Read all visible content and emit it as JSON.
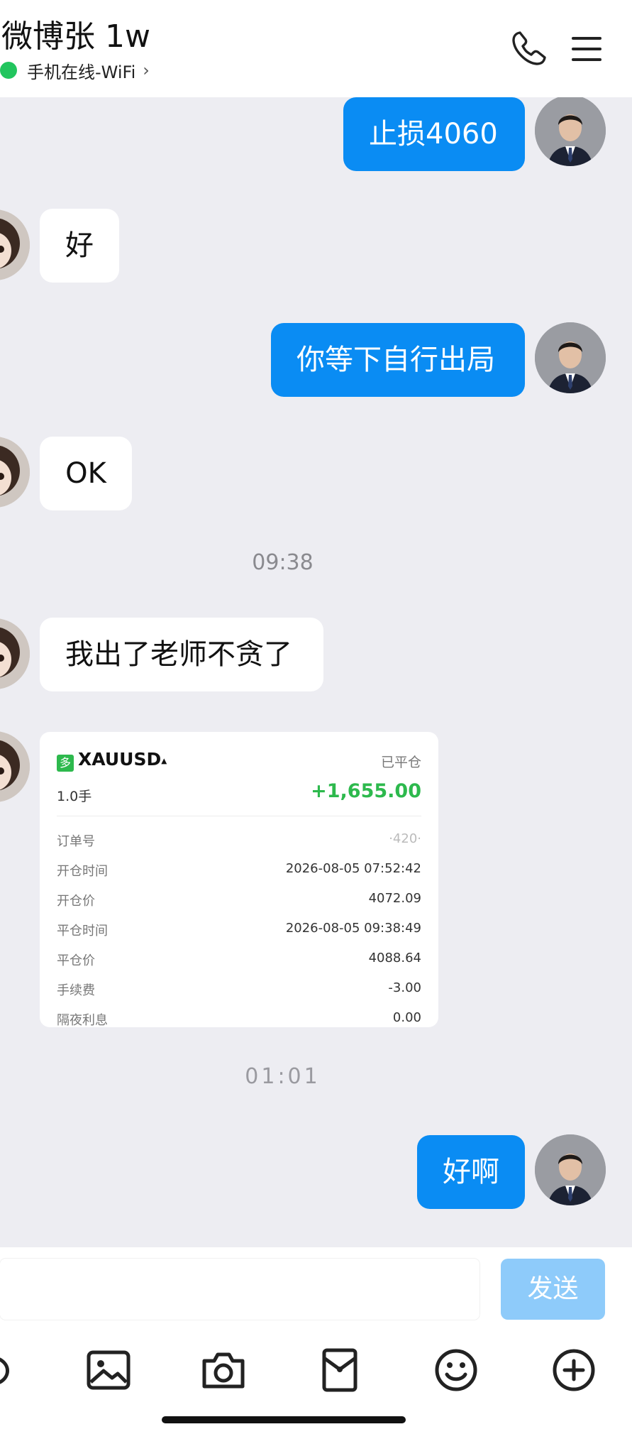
{
  "header": {
    "title": "微博张 1w",
    "status": "手机在线-WiFi",
    "status_chevron": "›",
    "icons": [
      "phone-icon",
      "menu-icon"
    ]
  },
  "messages": {
    "m1": "止损4060",
    "m2": "好",
    "m3": "你等下自行出局",
    "m4": "OK",
    "time1": "09:38",
    "m5": "我出了老师不贪了",
    "m6": "好啊",
    "time2": "01:01"
  },
  "trade_card": {
    "tag": "多",
    "symbol": "XAUUSD",
    "arrow": "▴",
    "status": "已平仓",
    "lots": "1.0手",
    "pnl": "+1,655.00",
    "rows": [
      {
        "label": "订单号",
        "value": "·420·"
      },
      {
        "label": "开仓时间",
        "value": "2026-08-05 07:52:42"
      },
      {
        "label": "开仓价",
        "value": "4072.09"
      },
      {
        "label": "平仓时间",
        "value": "2026-08-05 09:38:49"
      },
      {
        "label": "平仓价",
        "value": "4088.64"
      },
      {
        "label": "手续费",
        "value": "-3.00"
      },
      {
        "label": "隔夜利息",
        "value": "0.00"
      }
    ]
  },
  "composer": {
    "send_label": "发送",
    "tools": [
      "voice-icon",
      "image-icon",
      "camera-icon",
      "red-packet-icon",
      "emoji-icon",
      "plus-icon"
    ]
  },
  "colors": {
    "outgoing_bubble": "#0a8cf3",
    "incoming_bubble": "#ffffff",
    "online_dot": "#22c55e",
    "profit_green": "#2db94d",
    "send_button": "#8ecbfa"
  }
}
